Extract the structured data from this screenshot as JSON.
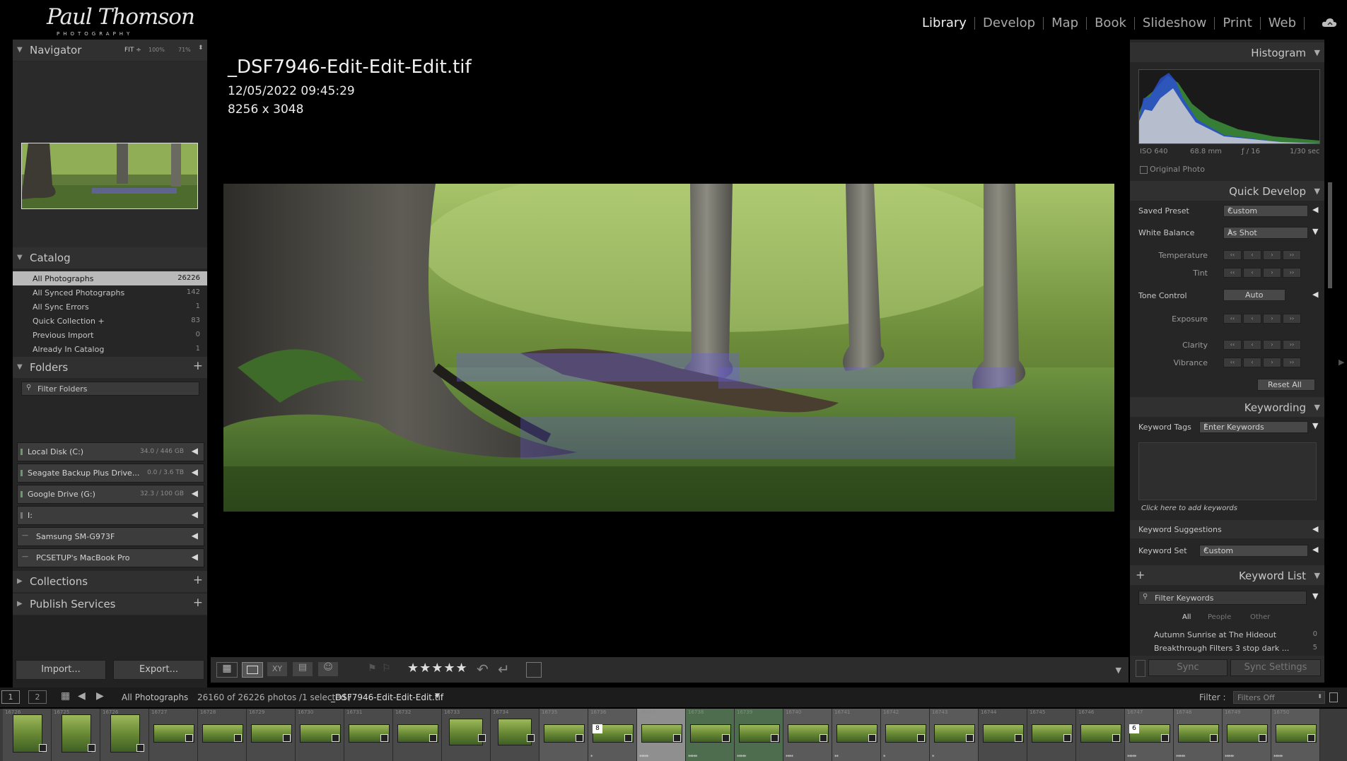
{
  "logo": {
    "line1": "Paul Thomson",
    "line2": "PHOTOGRAPHY"
  },
  "modules": [
    {
      "label": "Library",
      "active": true
    },
    {
      "label": "Develop",
      "active": false
    },
    {
      "label": "Map",
      "active": false
    },
    {
      "label": "Book",
      "active": false
    },
    {
      "label": "Slideshow",
      "active": false
    },
    {
      "label": "Print",
      "active": false
    },
    {
      "label": "Web",
      "active": false
    }
  ],
  "navigator": {
    "title": "Navigator",
    "fit": "FIT ÷",
    "z1": "100%",
    "z2": "71%"
  },
  "catalog": {
    "title": "Catalog",
    "items": [
      {
        "label": "All Photographs",
        "count": "26226",
        "selected": true
      },
      {
        "label": "All Synced Photographs",
        "count": "142"
      },
      {
        "label": "All Sync Errors",
        "count": "1"
      },
      {
        "label": "Quick Collection +",
        "count": "83"
      },
      {
        "label": "Previous Import",
        "count": "0"
      },
      {
        "label": "Already In Catalog",
        "count": "1"
      }
    ]
  },
  "folders": {
    "title": "Folders",
    "filter_placeholder": "Filter Folders",
    "items": [
      {
        "label": "Local Disk (C:)",
        "size": "34.0 / 446 GB"
      },
      {
        "label": "Seagate Backup Plus Drive...",
        "size": "0.0 / 3.6 TB"
      },
      {
        "label": "Google Drive (G:)",
        "size": "32.3 / 100 GB"
      },
      {
        "label": "I:",
        "size": ""
      },
      {
        "label": "Samsung SM-G973F",
        "size": ""
      },
      {
        "label": "PCSETUP's MacBook Pro",
        "size": ""
      }
    ]
  },
  "collections": {
    "title": "Collections"
  },
  "publish": {
    "title": "Publish Services"
  },
  "left_buttons": {
    "import": "Import...",
    "export": "Export..."
  },
  "photo_info": {
    "name": "_DSF7946-Edit-Edit-Edit.tif",
    "date": "12/05/2022 09:45:29",
    "dims": "8256 x 3048"
  },
  "histogram": {
    "title": "Histogram",
    "iso": "ISO 640",
    "focal": "68.8 mm",
    "aperture": "ƒ / 16",
    "shutter": "1/30 sec",
    "original": "Original Photo"
  },
  "quick_develop": {
    "title": "Quick Develop",
    "saved_preset_label": "Saved Preset",
    "saved_preset_value": "Custom",
    "wb_label": "White Balance",
    "wb_value": "As Shot",
    "temperature": "Temperature",
    "tint": "Tint",
    "tone_label": "Tone Control",
    "auto": "Auto",
    "exposure": "Exposure",
    "clarity": "Clarity",
    "vibrance": "Vibrance",
    "reset": "Reset All"
  },
  "keywording": {
    "title": "Keywording",
    "tags_label": "Keyword Tags",
    "tags_value": "Enter Keywords",
    "click_hint": "Click here to add keywords",
    "suggestions": "Keyword Suggestions",
    "set_label": "Keyword Set",
    "set_value": "Custom"
  },
  "keyword_list": {
    "title": "Keyword List",
    "filter_placeholder": "Filter Keywords",
    "tabs": [
      "All",
      "People",
      "Other"
    ],
    "items": [
      {
        "label": "Autumn Sunrise at The Hideout",
        "count": "0"
      },
      {
        "label": "Breakthrough Filters 3 stop dark ...",
        "count": "5"
      }
    ]
  },
  "sync": {
    "sync": "Sync",
    "settings": "Sync Settings"
  },
  "filmstrip_bar": {
    "page1": "1",
    "page2": "2",
    "source": "All Photographs",
    "count": "26160 of 26226 photos /1 selected /",
    "file": "_DSF7946-Edit-Edit-Edit.tif",
    "filter_label": "Filter :",
    "filter_value": "Filters Off"
  },
  "filmstrip": [
    {
      "num": "16726",
      "stars": "",
      "kind": "tall"
    },
    {
      "num": "16725",
      "stars": "",
      "kind": "tall"
    },
    {
      "num": "16726",
      "stars": "",
      "kind": "tall"
    },
    {
      "num": "16727",
      "stars": ""
    },
    {
      "num": "16728",
      "stars": ""
    },
    {
      "num": "16729",
      "stars": ""
    },
    {
      "num": "16730",
      "stars": ""
    },
    {
      "num": "16731",
      "stars": ""
    },
    {
      "num": "16732",
      "stars": ""
    },
    {
      "num": "16733",
      "stars": "",
      "kind": "sq"
    },
    {
      "num": "16734",
      "stars": "",
      "kind": "sq"
    },
    {
      "num": "16735",
      "stars": "",
      "bg": "lt"
    },
    {
      "num": "16736",
      "stars": "*",
      "badge": "8",
      "bg": "lt"
    },
    {
      "num": "16737",
      "stars": "*****",
      "bg": "cur"
    },
    {
      "num": "16738",
      "stars": "*****",
      "bg": "grn"
    },
    {
      "num": "16739",
      "stars": "*****",
      "bg": "grn"
    },
    {
      "num": "16740",
      "stars": "****",
      "bg": "lt"
    },
    {
      "num": "16741",
      "stars": "**",
      "bg": "lt"
    },
    {
      "num": "16742",
      "stars": "*",
      "bg": "lt"
    },
    {
      "num": "16743",
      "stars": "*",
      "bg": "lt"
    },
    {
      "num": "16744",
      "stars": ""
    },
    {
      "num": "16745",
      "stars": ""
    },
    {
      "num": "16746",
      "stars": ""
    },
    {
      "num": "16747",
      "stars": "*****",
      "badge": "6",
      "bg": "lt"
    },
    {
      "num": "16748",
      "stars": "*****",
      "bg": "lt"
    },
    {
      "num": "16749",
      "stars": "*****",
      "bg": "lt"
    },
    {
      "num": "16750",
      "stars": "*****",
      "bg": "lt"
    }
  ],
  "colors": {
    "bg": "#000000",
    "panel": "#262626",
    "accent_sel": "#b9b9b9"
  }
}
